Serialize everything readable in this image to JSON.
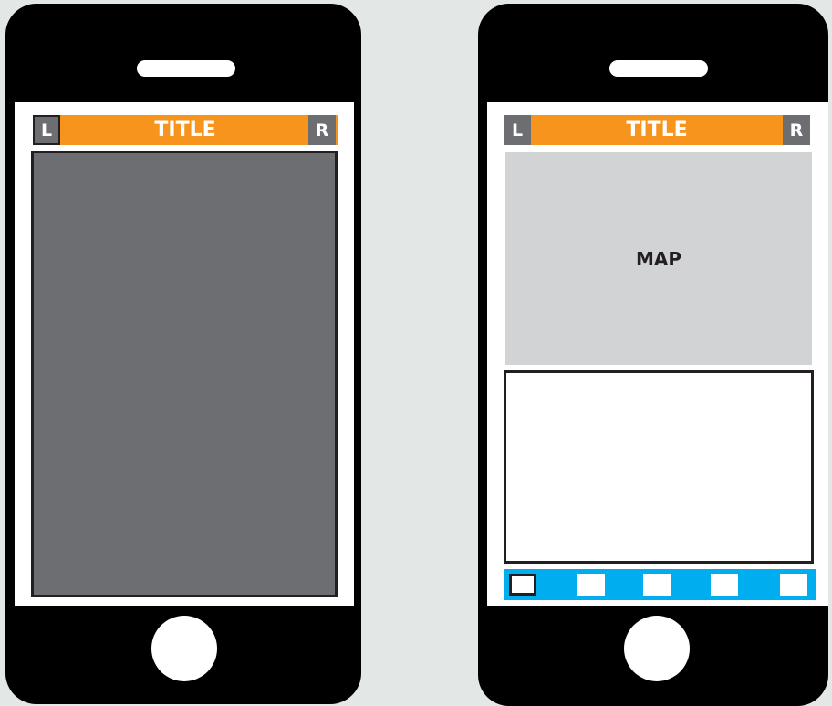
{
  "phone_left": {
    "header": {
      "left_label": "L",
      "title": "TITLE",
      "right_label": "R"
    }
  },
  "phone_right": {
    "header": {
      "left_label": "L",
      "title": "TITLE",
      "right_label": "R"
    },
    "map_label": "MAP",
    "tab_bar": {
      "tab_count": 5,
      "active_tab_index": 0
    }
  },
  "colors": {
    "background": "#e3e8e7",
    "phone_body": "#000000",
    "title_bar": "#f7941d",
    "nav_button": "#6d6e71",
    "content_dark": "#6d6e71",
    "map_area": "#d1d3d4",
    "tab_bar": "#00aeef"
  }
}
